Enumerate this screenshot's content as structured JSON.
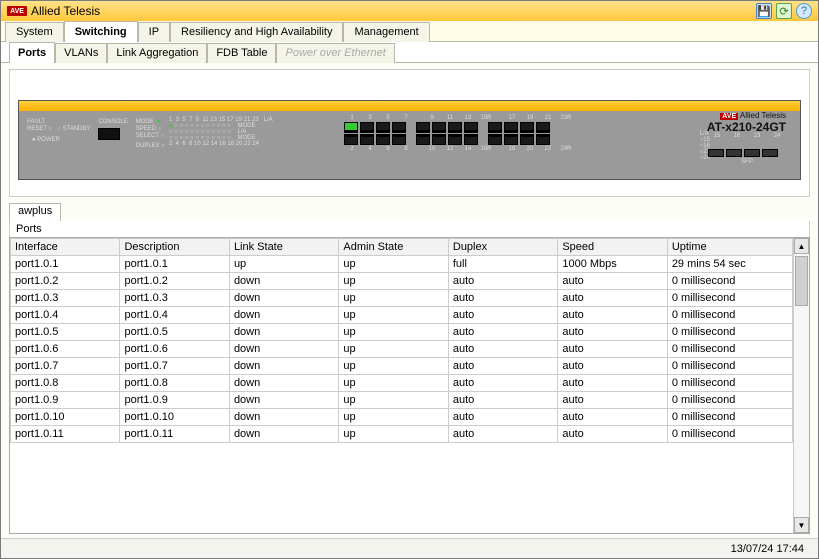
{
  "title": "Allied Telesis",
  "main_tabs": [
    "System",
    "Switching",
    "IP",
    "Resiliency and High Availability",
    "Management"
  ],
  "main_active": "Switching",
  "sub_tabs": [
    "Ports",
    "VLANs",
    "Link Aggregation",
    "FDB Table",
    "Power over Ethernet"
  ],
  "sub_active": "Ports",
  "sub_disabled": "Power over Ethernet",
  "device": {
    "brand_text": "Allied Telesis",
    "model": "AT-x210-24GT",
    "port_nums_top": [
      "1",
      "3",
      "5",
      "7",
      "9",
      "11",
      "13",
      "15R",
      "17",
      "19",
      "21",
      "23R"
    ],
    "port_nums_bottom": [
      "2",
      "4",
      "6",
      "8",
      "10",
      "12",
      "14",
      "16R",
      "18",
      "20",
      "22",
      "24R"
    ],
    "la_lines": [
      "L/A",
      "○15",
      "○16",
      "○23",
      "○24"
    ],
    "sfp_nums": [
      "15",
      "16",
      "23",
      "24"
    ],
    "sfp_label": "SFP",
    "left_labels": {
      "fault": "FAULT",
      "reset": "RESET",
      "standby": "STANDBY",
      "power": "POWER",
      "console": "CONSOLE",
      "mode": "MODE",
      "speed": "SPEED",
      "select": "SELECT",
      "duplex": "DUPLEX ○"
    }
  },
  "host_tab": "awplus",
  "section_label": "Ports",
  "columns": [
    "Interface",
    "Description",
    "Link State",
    "Admin State",
    "Duplex",
    "Speed",
    "Uptime"
  ],
  "rows": [
    {
      "iface": "port1.0.1",
      "desc": "port1.0.1",
      "link": "up",
      "admin": "up",
      "duplex": "full",
      "speed": "1000 Mbps",
      "uptime": "29 mins 54 sec"
    },
    {
      "iface": "port1.0.2",
      "desc": "port1.0.2",
      "link": "down",
      "admin": "up",
      "duplex": "auto",
      "speed": "auto",
      "uptime": "0 millisecond"
    },
    {
      "iface": "port1.0.3",
      "desc": "port1.0.3",
      "link": "down",
      "admin": "up",
      "duplex": "auto",
      "speed": "auto",
      "uptime": "0 millisecond"
    },
    {
      "iface": "port1.0.4",
      "desc": "port1.0.4",
      "link": "down",
      "admin": "up",
      "duplex": "auto",
      "speed": "auto",
      "uptime": "0 millisecond"
    },
    {
      "iface": "port1.0.5",
      "desc": "port1.0.5",
      "link": "down",
      "admin": "up",
      "duplex": "auto",
      "speed": "auto",
      "uptime": "0 millisecond"
    },
    {
      "iface": "port1.0.6",
      "desc": "port1.0.6",
      "link": "down",
      "admin": "up",
      "duplex": "auto",
      "speed": "auto",
      "uptime": "0 millisecond"
    },
    {
      "iface": "port1.0.7",
      "desc": "port1.0.7",
      "link": "down",
      "admin": "up",
      "duplex": "auto",
      "speed": "auto",
      "uptime": "0 millisecond"
    },
    {
      "iface": "port1.0.8",
      "desc": "port1.0.8",
      "link": "down",
      "admin": "up",
      "duplex": "auto",
      "speed": "auto",
      "uptime": "0 millisecond"
    },
    {
      "iface": "port1.0.9",
      "desc": "port1.0.9",
      "link": "down",
      "admin": "up",
      "duplex": "auto",
      "speed": "auto",
      "uptime": "0 millisecond"
    },
    {
      "iface": "port1.0.10",
      "desc": "port1.0.10",
      "link": "down",
      "admin": "up",
      "duplex": "auto",
      "speed": "auto",
      "uptime": "0 millisecond"
    },
    {
      "iface": "port1.0.11",
      "desc": "port1.0.11",
      "link": "down",
      "admin": "up",
      "duplex": "auto",
      "speed": "auto",
      "uptime": "0 millisecond"
    }
  ],
  "status_time": "13/07/24 17:44"
}
